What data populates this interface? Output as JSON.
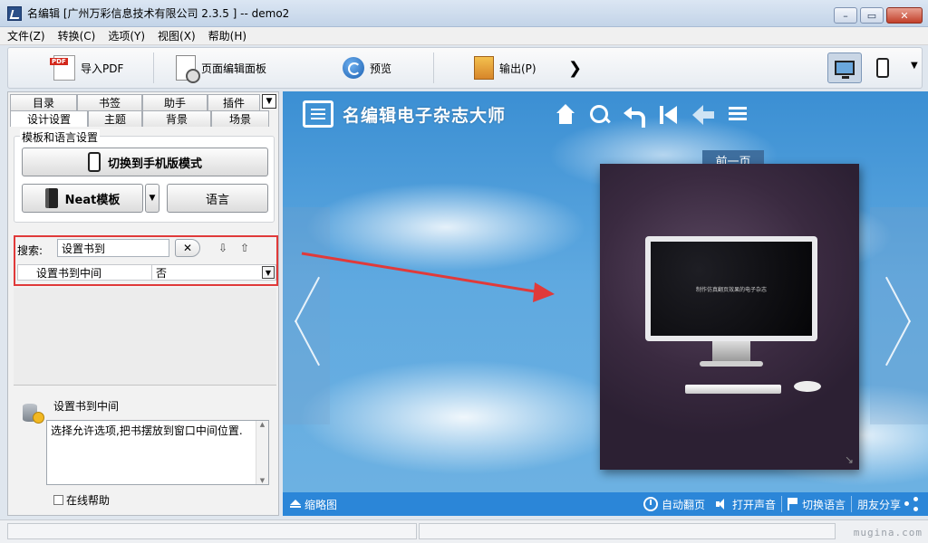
{
  "window": {
    "title": "名编辑 [广州万彩信息技术有限公司 2.3.5 ] -- demo2",
    "minimize": "–",
    "maximize": "▭",
    "close": "✕"
  },
  "menu": [
    "文件(Z)",
    "转换(C)",
    "选项(Y)",
    "视图(X)",
    "帮助(H)"
  ],
  "toolbar": {
    "import_pdf": "导入PDF",
    "page_editor": "页面编辑面板",
    "preview": "预览",
    "output": "输出(P)",
    "more": "❯",
    "dropdown": "▼"
  },
  "tabs": {
    "row1": [
      "目录",
      "书签",
      "助手",
      "插件"
    ],
    "row1_more": "▼",
    "row2": [
      "设计设置",
      "主题",
      "背景",
      "场景"
    ]
  },
  "template_group": {
    "label": "模板和语言设置",
    "mobile_mode_button": "切换到手机版模式",
    "template_button": "Neat模板",
    "template_dropdown": "▼",
    "language_button": "语言"
  },
  "search": {
    "label": "搜索:",
    "value": "设置书到",
    "clear": "✕",
    "sort_down": "⇩",
    "sort_up": "⇧"
  },
  "property": {
    "name": "设置书到中间",
    "value": "否",
    "dropdown": "▼"
  },
  "description": {
    "title": "设置书到中间",
    "text": "选择允许选项,把书摆放到窗口中间位置.",
    "online_help": "在线帮助",
    "online_help_checked": false
  },
  "preview": {
    "logo_text": "名编辑电子杂志大师",
    "prev_page_label": "前一页",
    "book_caption": "制作仿真翻页效果的电子杂志",
    "corner_arrow": "↘",
    "bottom": {
      "thumbnails": "缩略图",
      "auto_flip": "自动翻页",
      "open_sound": "打开声音",
      "switch_language": "切换语言",
      "share": "朋友分享"
    },
    "colors": {
      "sky": "#4a9bd9",
      "bottom_bar": "#2b86d8",
      "annotation": "#e03a3a"
    }
  },
  "statusbar": {
    "watermark": "mugina.com"
  }
}
